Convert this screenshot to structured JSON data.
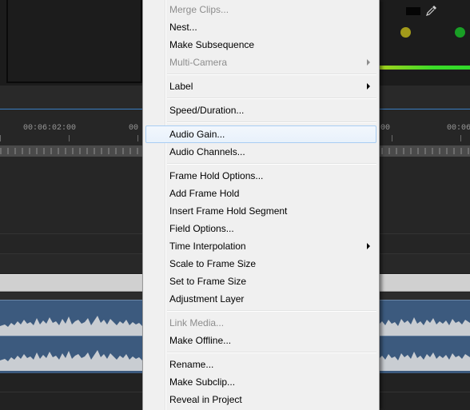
{
  "timeline": {
    "timecodes": [
      "00:06:02:00",
      "00",
      "00",
      "00:06"
    ]
  },
  "menu": {
    "items": [
      {
        "label": "Merge Clips...",
        "disabled": true
      },
      {
        "label": "Nest..."
      },
      {
        "label": "Make Subsequence"
      },
      {
        "label": "Multi-Camera",
        "disabled": true,
        "submenu": true
      },
      {
        "label": "Label",
        "submenu": true
      },
      {
        "label": "Speed/Duration..."
      },
      {
        "label": "Audio Gain...",
        "highlighted": true
      },
      {
        "label": "Audio Channels..."
      },
      {
        "label": "Frame Hold Options..."
      },
      {
        "label": "Add Frame Hold"
      },
      {
        "label": "Insert Frame Hold Segment"
      },
      {
        "label": "Field Options..."
      },
      {
        "label": "Time Interpolation",
        "submenu": true
      },
      {
        "label": "Scale to Frame Size"
      },
      {
        "label": "Set to Frame Size"
      },
      {
        "label": "Adjustment Layer"
      },
      {
        "label": "Link Media...",
        "disabled": true
      },
      {
        "label": "Make Offline..."
      },
      {
        "label": "Rename..."
      },
      {
        "label": "Make Subclip..."
      },
      {
        "label": "Reveal in Project"
      }
    ]
  },
  "colors": {
    "menu_bg": "#f0f0f0",
    "highlight_border": "#a8cdf3",
    "audio_clip": "#3c5a7e",
    "meter_green": "#31d82a",
    "indicator_yellow": "#a29a1a",
    "indicator_green": "#199f25"
  }
}
